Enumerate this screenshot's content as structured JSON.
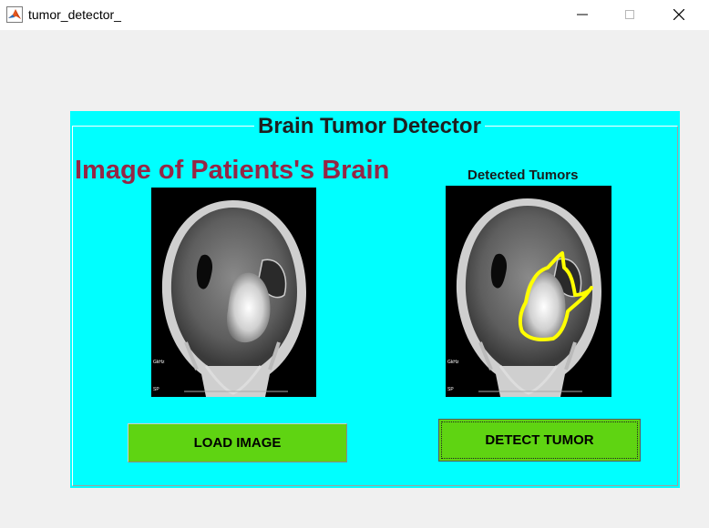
{
  "window": {
    "title": "tumor_detector_",
    "app_icon": "matlab-icon",
    "controls": [
      "minimize-icon",
      "maximize-icon",
      "close-icon"
    ]
  },
  "panel": {
    "title": "Brain Tumor Detector",
    "background": "#00ffff"
  },
  "left": {
    "heading": "Image of Patients's Brain",
    "heading_color": "#952645",
    "scan_text": [
      "GkHz",
      "SP"
    ],
    "button_label": "LOAD IMAGE"
  },
  "right": {
    "heading": "Detected Tumors",
    "scan_text": [
      "GkHz",
      "SP"
    ],
    "outline_color": "#ffff00",
    "button_label": "DETECT TUMOR"
  },
  "button_color": "#5fd412"
}
